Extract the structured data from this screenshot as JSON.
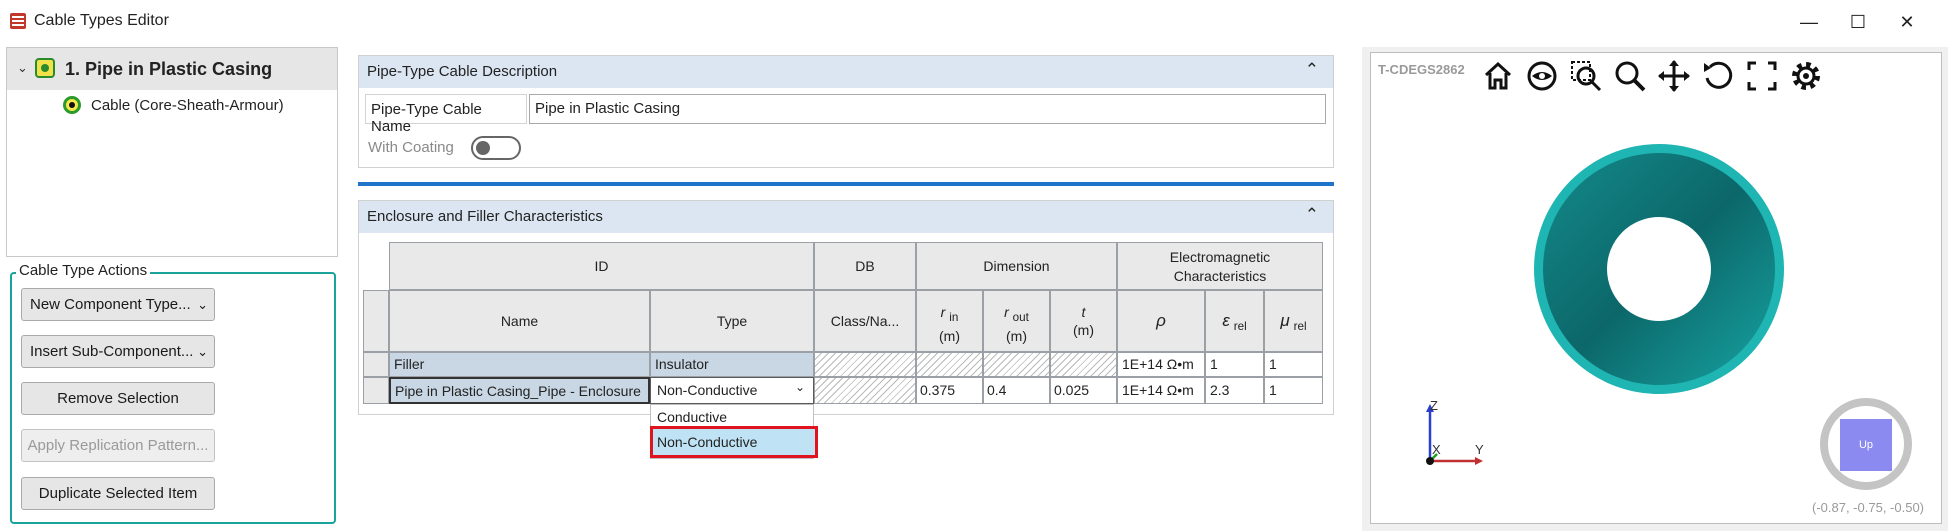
{
  "window": {
    "title": "Cable Types Editor",
    "minimize": "—",
    "maximize": "☐",
    "close": "✕"
  },
  "tree": {
    "root_label": "1. Pipe in Plastic Casing",
    "child_label": "Cable (Core-Sheath-Armour)"
  },
  "actions": {
    "legend": "Cable Type Actions",
    "new_component": "New Component Type...",
    "insert_sub": "Insert Sub-Component...",
    "remove": "Remove Selection",
    "apply_replication": "Apply Replication Pattern...",
    "duplicate": "Duplicate Selected Item"
  },
  "description": {
    "header": "Pipe-Type Cable Description",
    "name_label": "Pipe-Type Cable Name",
    "name_value": "Pipe in Plastic Casing",
    "coating_label": "With Coating",
    "coating_on": false
  },
  "enclosure": {
    "header": "Enclosure and Filler Characteristics",
    "groups": {
      "id": "ID",
      "db": "DB",
      "dimension": "Dimension",
      "em_line1": "Electromagnetic",
      "em_line2": "Characteristics"
    },
    "columns": {
      "name": "Name",
      "type": "Type",
      "class": "Class/Na...",
      "rin_main": "r",
      "rin_sub": "in",
      "rin_unit": "(m)",
      "rout_main": "r",
      "rout_sub": "out",
      "rout_unit": "(m)",
      "t_main": "t",
      "t_unit": "(m)",
      "rho": "ρ",
      "eps_main": "ε",
      "eps_sub": "rel",
      "mu_main": "μ",
      "mu_sub": "rel"
    },
    "rows": [
      {
        "name": "Filler",
        "type": "Insulator",
        "rin": "",
        "rout": "",
        "t": "",
        "rho": "1E+14 Ω•m",
        "eps": "1",
        "mu": "1"
      },
      {
        "name": "Pipe in Plastic Casing_Pipe - Enclosure",
        "type": "Non-Conductive",
        "rin": "0.375",
        "rout": "0.4",
        "t": "0.025",
        "rho": "1E+14 Ω•m",
        "eps": "2.3",
        "mu": "1"
      }
    ],
    "dropdown_options": [
      "Conductive",
      "Non-Conductive"
    ]
  },
  "viewer": {
    "id_label": "T-CDEGS2862",
    "toolbar_icons": [
      "home-icon",
      "eye-icon",
      "zoom-region-icon",
      "zoom-icon",
      "pan-icon",
      "rotate-icon",
      "fullscreen-icon",
      "settings-icon"
    ],
    "axis_z": "Z",
    "axis_x": "X",
    "axis_y": "Y",
    "up_label": "Up",
    "coords": "(-0.87, -0.75, -0.50)",
    "ring_color": "#1fb5b3"
  }
}
